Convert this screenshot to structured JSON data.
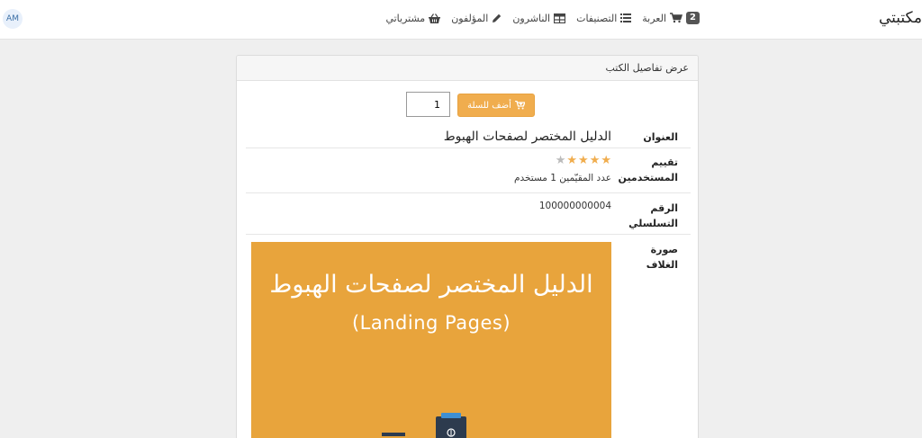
{
  "navbar": {
    "brand": "مكتبتي",
    "cart_count": "2",
    "cart_label": "العربة",
    "categories_label": "التصنيفات",
    "publishers_label": "الناشرون",
    "authors_label": "المؤلفون",
    "purchases_label": "مشترياتي",
    "avatar_initials": "AM"
  },
  "panel": {
    "header": "عرض تفاصيل الكتب",
    "quantity_value": "1",
    "add_to_cart_label": "أضف للسلة"
  },
  "details": {
    "title_label": "العنوان",
    "title_value": "الدليل المختصر لصفحات الهبوط",
    "rating_label_line1": "تقييم",
    "rating_label_line2": "المستخدمين",
    "rating_value": 4,
    "rating_max": 5,
    "raters_text": "عدد المقيّمين 1 مستخدم",
    "serial_label_line1": "الرقم",
    "serial_label_line2": "التسلسلي",
    "serial_value": "100000000004",
    "cover_label": "صورة الغلاف"
  },
  "cover": {
    "title": "الدليل المختصر لصفحات الهبوط",
    "subtitle": "(Landing Pages)",
    "background_color": "#e8a43c"
  },
  "colors": {
    "accent": "#f0ad4e"
  }
}
